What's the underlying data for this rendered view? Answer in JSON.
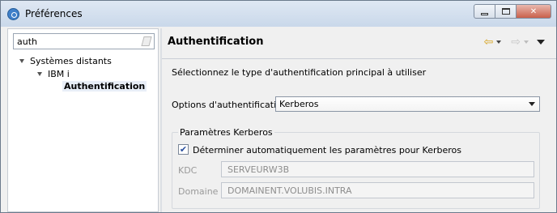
{
  "window": {
    "title": "Préférences"
  },
  "filter": {
    "value": "auth"
  },
  "tree": {
    "items": [
      {
        "label": "Systèmes distants"
      },
      {
        "label": "IBM i"
      },
      {
        "label": "Authentification"
      }
    ]
  },
  "page": {
    "title": "Authentification",
    "description": "Sélectionnez le type d'authentification principal à utiliser",
    "auth_options_label": "Options d'authentification",
    "auth_options_value": "Kerberos",
    "group_title": "Paramètres Kerberos",
    "auto_checkbox_label": "Déterminer automatiquement les paramètres pour Kerberos",
    "auto_checkbox_checked": true,
    "kdc_label": "KDC",
    "kdc_value": "SERVEURW3B",
    "domain_label": "Domaine",
    "domain_value": "DOMAINENT.VOLUBIS.INTRA"
  },
  "icons": {
    "app": "eclipse-icon",
    "back": "back-arrow-icon",
    "forward": "forward-arrow-icon",
    "menu": "view-menu-icon",
    "clear": "clear-filter-icon"
  },
  "colors": {
    "window_bg": "#f0f0f0",
    "titlebar": "#c9d8ea",
    "back_arrow": "#d6a21c",
    "selection": "#e8eef7"
  }
}
